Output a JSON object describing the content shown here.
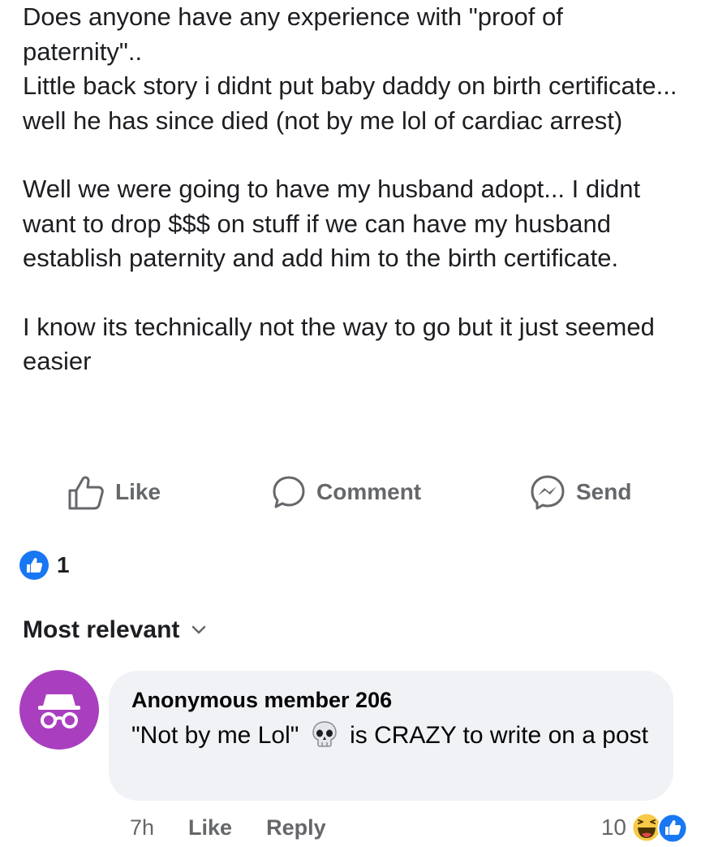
{
  "post": {
    "paragraphs": [
      "Does anyone have any experience with \"proof of paternity\"..\nLittle back story i didnt put baby daddy on birth certificate... well he has since died (not by me lol of cardiac arrest)",
      "Well we were going to have my husband adopt... I didnt want to drop $$$ on stuff if we can have my husband establish paternity and add him to the birth certificate.",
      "I know its technically not the way to go but it just seemed easier"
    ]
  },
  "actions": {
    "like": "Like",
    "comment": "Comment",
    "send": "Send"
  },
  "reactions": {
    "count": "1"
  },
  "comments_sort": {
    "label": "Most relevant"
  },
  "comment": {
    "author": "Anonymous member 206",
    "text_before": "\"Not by me Lol\"",
    "text_after": "is CRAZY to write on a post",
    "time": "7h",
    "like": "Like",
    "reply": "Reply",
    "reaction_count": "10"
  },
  "icons": {
    "like": "thumbs-up-icon",
    "comment": "comment-bubble-icon",
    "send": "messenger-icon",
    "skull": "skull-emoji",
    "haha": "haha-reaction-icon",
    "like_reaction": "like-reaction-icon",
    "avatar": "anonymous-incognito-icon",
    "chevron": "chevron-down-icon"
  },
  "colors": {
    "accent": "#1877f2",
    "avatar_bg": "#a93fbf",
    "bubble_bg": "#f0f2f5",
    "meta_text": "#65676b"
  }
}
